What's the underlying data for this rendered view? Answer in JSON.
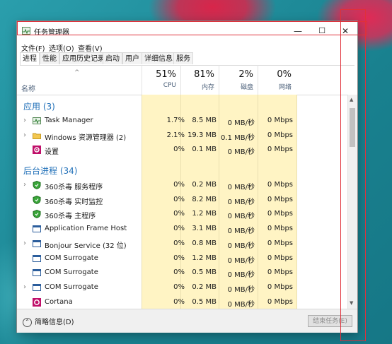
{
  "window": {
    "title": "任务管理器",
    "minimize": "—",
    "maximize": "☐",
    "close": "✕"
  },
  "menu": [
    "文件(F)",
    "选项(O)",
    "查看(V)"
  ],
  "tabs": [
    "进程",
    "性能",
    "应用历史记录",
    "启动",
    "用户",
    "详细信息",
    "服务"
  ],
  "header": {
    "name_label": "名称",
    "sort_caret": "^",
    "columns": [
      {
        "pct": "51%",
        "label": "CPU"
      },
      {
        "pct": "81%",
        "label": "内存"
      },
      {
        "pct": "2%",
        "label": "磁盘"
      },
      {
        "pct": "0%",
        "label": "网络"
      }
    ]
  },
  "sections": {
    "apps": "应用 (3)",
    "background": "后台进程 (34)"
  },
  "apps": [
    {
      "name": "Task Manager",
      "cpu": "1.7%",
      "mem": "8.5 MB",
      "disk": "0 MB/秒",
      "net": "0 Mbps",
      "expand": true,
      "icon": "task-manager-icon"
    },
    {
      "name": "Windows 资源管理器 (2)",
      "cpu": "2.1%",
      "mem": "19.3 MB",
      "disk": "0.1 MB/秒",
      "net": "0 Mbps",
      "expand": true,
      "icon": "folder-icon"
    },
    {
      "name": "设置",
      "cpu": "0%",
      "mem": "0.1 MB",
      "disk": "0 MB/秒",
      "net": "0 Mbps",
      "expand": false,
      "icon": "settings-gear-icon"
    }
  ],
  "background": [
    {
      "name": "360杀毒 服务程序",
      "cpu": "0%",
      "mem": "0.2 MB",
      "disk": "0 MB/秒",
      "net": "0 Mbps",
      "expand": true,
      "icon": "shield-icon"
    },
    {
      "name": "360杀毒 实时监控",
      "cpu": "0%",
      "mem": "8.2 MB",
      "disk": "0 MB/秒",
      "net": "0 Mbps",
      "expand": false,
      "icon": "shield-icon"
    },
    {
      "name": "360杀毒 主程序",
      "cpu": "0%",
      "mem": "1.2 MB",
      "disk": "0 MB/秒",
      "net": "0 Mbps",
      "expand": false,
      "icon": "shield-icon"
    },
    {
      "name": "Application Frame Host",
      "cpu": "0%",
      "mem": "3.1 MB",
      "disk": "0 MB/秒",
      "net": "0 Mbps",
      "expand": false,
      "icon": "app-window-icon"
    },
    {
      "name": "Bonjour Service (32 位)",
      "cpu": "0%",
      "mem": "0.8 MB",
      "disk": "0 MB/秒",
      "net": "0 Mbps",
      "expand": true,
      "icon": "app-window-icon"
    },
    {
      "name": "COM Surrogate",
      "cpu": "0%",
      "mem": "1.2 MB",
      "disk": "0 MB/秒",
      "net": "0 Mbps",
      "expand": false,
      "icon": "app-window-icon"
    },
    {
      "name": "COM Surrogate",
      "cpu": "0%",
      "mem": "0.5 MB",
      "disk": "0 MB/秒",
      "net": "0 Mbps",
      "expand": false,
      "icon": "app-window-icon"
    },
    {
      "name": "COM Surrogate",
      "cpu": "0%",
      "mem": "0.2 MB",
      "disk": "0 MB/秒",
      "net": "0 Mbps",
      "expand": true,
      "icon": "app-window-icon"
    },
    {
      "name": "Cortana",
      "cpu": "0%",
      "mem": "0.5 MB",
      "disk": "0 MB/秒",
      "net": "0 Mbps",
      "expand": false,
      "icon": "cortana-icon"
    }
  ],
  "footer": {
    "fewer_details": "简略信息(D)",
    "end_task": "结束任务(E)"
  },
  "colors": {
    "heat_light": "#fff4c4",
    "heat_medium": "#ffe9a0",
    "section_blue": "#1f6fb8"
  }
}
